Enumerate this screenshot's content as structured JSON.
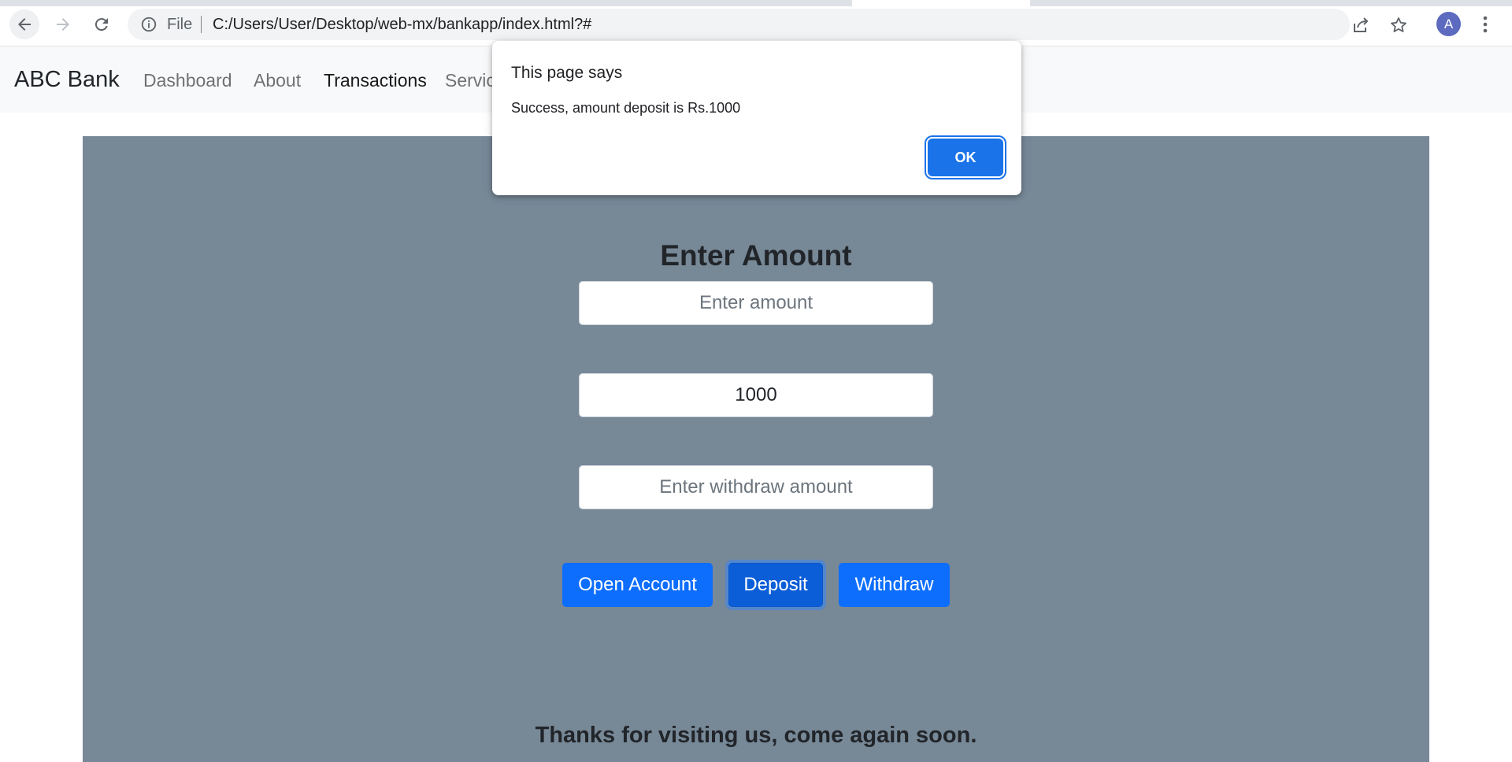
{
  "browser": {
    "file_label": "File",
    "url": "C:/Users/User/Desktop/web-mx/bankapp/index.html?#",
    "profile_initial": "A"
  },
  "navbar": {
    "brand": "ABC Bank",
    "links": [
      {
        "label": "Dashboard"
      },
      {
        "label": "About"
      },
      {
        "label": "Transactions"
      },
      {
        "label": "Servic"
      }
    ]
  },
  "form": {
    "heading": "Enter Amount",
    "amount": {
      "placeholder": "Enter amount",
      "value": ""
    },
    "deposit": {
      "value": "1000"
    },
    "withdraw": {
      "placeholder": "Enter withdraw amount",
      "value": ""
    },
    "buttons": {
      "open_account": "Open Account",
      "deposit": "Deposit",
      "withdraw": "Withdraw"
    }
  },
  "footer": {
    "text": "Thanks for visiting us, come again soon."
  },
  "alert": {
    "title": "This page says",
    "message": "Success, amount deposit is Rs.1000",
    "ok_label": "OK"
  },
  "colors": {
    "panel_bg": "#778897",
    "primary": "#0d6efd",
    "alert_button": "#1a73e8"
  }
}
